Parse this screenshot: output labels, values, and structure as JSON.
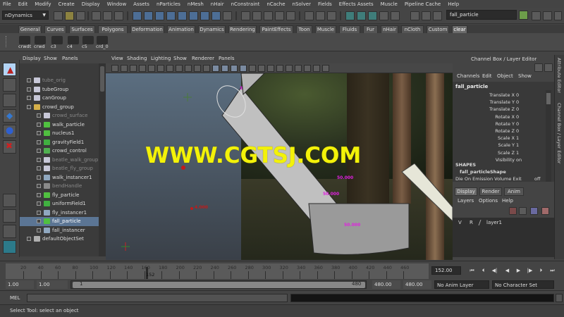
{
  "menu": [
    "File",
    "Edit",
    "Modify",
    "Create",
    "Display",
    "Window",
    "Assets",
    "nParticles",
    "nMesh",
    "nHair",
    "nConstraint",
    "nCache",
    "nSolver",
    "Fields",
    "Effects Assets",
    "Muscle",
    "Pipeline Cache",
    "Help"
  ],
  "status": {
    "menuset": "nDynamics",
    "search_value": "fall_particle"
  },
  "shelf": {
    "tabs": [
      "General",
      "Curves",
      "Surfaces",
      "Polygons",
      "Deformation",
      "Animation",
      "Dynamics",
      "Rendering",
      "PaintEffects",
      "Toon",
      "Muscle",
      "Fluids",
      "Fur",
      "nHair",
      "nCloth",
      "Custom",
      "clear"
    ],
    "selected_tab": "clear",
    "buttons": [
      "crwdt",
      "crwd",
      "c3",
      "c4",
      "c5",
      "crd_0"
    ]
  },
  "outliner": {
    "menu": [
      "Display",
      "Show",
      "Panels"
    ],
    "items": [
      {
        "label": "tube_orig",
        "indent": 1,
        "dim": true,
        "icon": "mesh"
      },
      {
        "label": "tubeGroup",
        "indent": 1,
        "icon": "mesh"
      },
      {
        "label": "canGroup",
        "indent": 1,
        "icon": "mesh"
      },
      {
        "label": "crowd_group",
        "indent": 1,
        "icon": "group",
        "expanded": true
      },
      {
        "label": "crowd_surface",
        "indent": 2,
        "dim": true,
        "icon": "mesh"
      },
      {
        "label": "walk_particle",
        "indent": 2,
        "icon": "particle"
      },
      {
        "label": "nucleus1",
        "indent": 2,
        "icon": "particle"
      },
      {
        "label": "gravityField1",
        "indent": 2,
        "icon": "field"
      },
      {
        "label": "crowd_control",
        "indent": 2,
        "icon": "curve"
      },
      {
        "label": "beatle_walk_group",
        "indent": 2,
        "dim": true,
        "icon": "mesh"
      },
      {
        "label": "beatle_fly_group",
        "indent": 2,
        "dim": true,
        "icon": "mesh"
      },
      {
        "label": "walk_instancer1",
        "indent": 2,
        "icon": "instancer"
      },
      {
        "label": "bendHandle",
        "indent": 2,
        "dim": true,
        "icon": "handle"
      },
      {
        "label": "fly_particle",
        "indent": 2,
        "icon": "particle"
      },
      {
        "label": "uniformField1",
        "indent": 2,
        "icon": "field"
      },
      {
        "label": "fly_instancer1",
        "indent": 2,
        "icon": "instancer"
      },
      {
        "label": "fall_particle",
        "indent": 2,
        "selected": true,
        "icon": "particle"
      },
      {
        "label": "fall_instancer",
        "indent": 2,
        "icon": "instancer"
      },
      {
        "label": "defaultObjectSet",
        "indent": 1,
        "icon": "set"
      }
    ]
  },
  "viewport": {
    "menu": [
      "View",
      "Shading",
      "Lighting",
      "Show",
      "Renderer",
      "Panels"
    ],
    "labels": [
      {
        "text": "4.000",
        "color": "#c21a1a"
      },
      {
        "text": "50.000",
        "color": "#e020e0"
      },
      {
        "text": "50.000",
        "color": "#e020e0"
      },
      {
        "text": "50.000",
        "color": "#e020e0"
      },
      {
        "text": "3",
        "color": "#e020e0"
      }
    ],
    "watermark": "WWW.CGTSJ.COM"
  },
  "channelbox": {
    "title": "Channel Box / Layer Editor",
    "menu": [
      "Channels",
      "Edit",
      "Object",
      "Show"
    ],
    "object": "fall_particle",
    "attrs": [
      {
        "name": "Translate X",
        "value": "0"
      },
      {
        "name": "Translate Y",
        "value": "0"
      },
      {
        "name": "Translate Z",
        "value": "0"
      },
      {
        "name": "Rotate X",
        "value": "0"
      },
      {
        "name": "Rotate Y",
        "value": "0"
      },
      {
        "name": "Rotate Z",
        "value": "0"
      },
      {
        "name": "Scale X",
        "value": "1"
      },
      {
        "name": "Scale Y",
        "value": "1"
      },
      {
        "name": "Scale Z",
        "value": "1"
      },
      {
        "name": "Visibility",
        "value": "on"
      }
    ],
    "shapes_header": "SHAPES",
    "shape_name": "fall_particleShape",
    "shape_attr": {
      "name": "Die On Emission Volume Exit",
      "value": "off"
    }
  },
  "layers": {
    "tabs": [
      "Display",
      "Render",
      "Anim"
    ],
    "menu": [
      "Layers",
      "Options",
      "Help"
    ],
    "rows": [
      {
        "v": "V",
        "r": "R",
        "name": "layer1"
      }
    ]
  },
  "vertical_tabs": [
    "Attribute Editor",
    "Channel Box / Layer Editor"
  ],
  "timeline": {
    "ticks": [
      "20",
      "40",
      "60",
      "80",
      "100",
      "120",
      "140",
      "160",
      "180",
      "200",
      "220",
      "240",
      "260",
      "280",
      "300",
      "320",
      "340",
      "360",
      "380",
      "400",
      "420",
      "440",
      "460"
    ],
    "current_label": "152",
    "current_frame": "152.00"
  },
  "range": {
    "start": "1.00",
    "playback_start": "1.00",
    "bar_left": "1",
    "bar_right": "480",
    "playback_end": "480.00",
    "end": "480.00",
    "anim_layer": "No Anim Layer",
    "character": "No Character Set"
  },
  "commandline": {
    "label": "MEL"
  },
  "helpline": "Select Tool: select an object"
}
